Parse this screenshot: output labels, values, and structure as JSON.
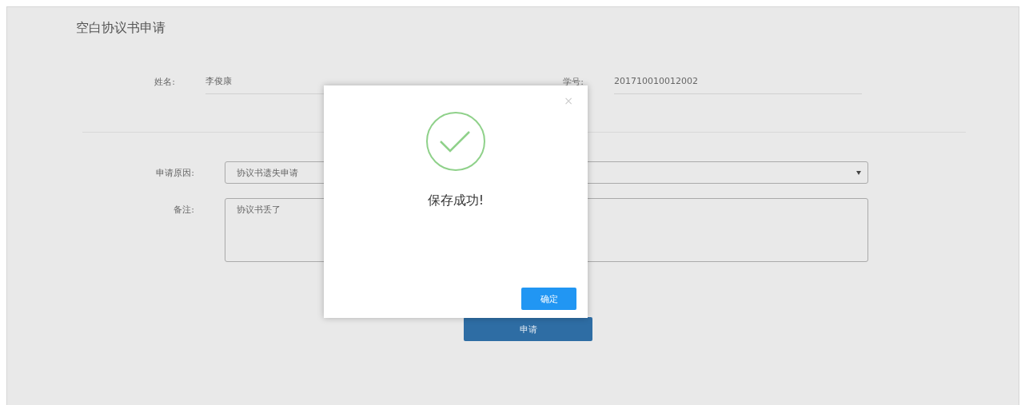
{
  "page": {
    "title": "空白协议书申请"
  },
  "info": [
    {
      "label": "姓名:",
      "value": "李俊康"
    },
    {
      "label": "学号:",
      "value": "201710010012002"
    }
  ],
  "form": {
    "reason": {
      "label": "申请原因:",
      "value": "协议书遗失申请"
    },
    "remark": {
      "label": "备注:",
      "value": "协议书丢了"
    },
    "submit": "申请"
  },
  "dialog": {
    "close": "×",
    "message": "保存成功!",
    "confirm": "确定"
  }
}
